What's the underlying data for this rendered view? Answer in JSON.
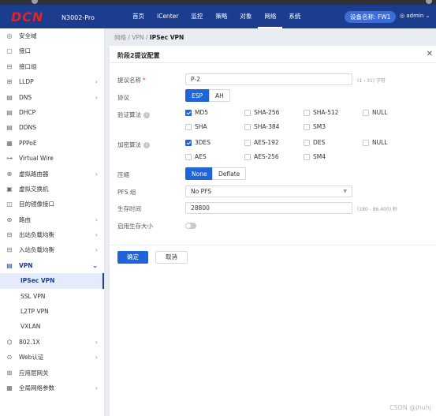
{
  "header": {
    "logo": "DCN",
    "model": "N3002-Pro",
    "nav": [
      "首页",
      "iCenter",
      "监控",
      "策略",
      "对象",
      "网络",
      "系统"
    ],
    "active_nav": "网络",
    "device_badge": "设备名称: FW1",
    "user": "admin"
  },
  "sidebar": {
    "items": [
      {
        "label": "安全域",
        "icon": "shield-icon",
        "glyph": "◎"
      },
      {
        "label": "接口",
        "icon": "interface-icon",
        "glyph": "▢"
      },
      {
        "label": "接口组",
        "icon": "interface-group-icon",
        "glyph": "⊟"
      },
      {
        "label": "LLDP",
        "icon": "lldp-icon",
        "glyph": "⊞",
        "arrow": true
      },
      {
        "label": "DNS",
        "icon": "dns-icon",
        "glyph": "▤",
        "arrow": true
      },
      {
        "label": "DHCP",
        "icon": "dhcp-icon",
        "glyph": "▤"
      },
      {
        "label": "DDNS",
        "icon": "ddns-icon",
        "glyph": "▤"
      },
      {
        "label": "PPPoE",
        "icon": "pppoe-icon",
        "glyph": "▦"
      },
      {
        "label": "Virtual Wire",
        "icon": "virtual-wire-icon",
        "glyph": "⊶"
      },
      {
        "label": "虚拟路由器",
        "icon": "virtual-router-icon",
        "glyph": "⊕",
        "arrow": true
      },
      {
        "label": "虚拟交换机",
        "icon": "virtual-switch-icon",
        "glyph": "▣"
      },
      {
        "label": "目的镜像接口",
        "icon": "mirror-icon",
        "glyph": "◫"
      },
      {
        "label": "路由",
        "icon": "route-icon",
        "glyph": "⊛",
        "arrow": true
      },
      {
        "label": "出站负载均衡",
        "icon": "outbound-lb-icon",
        "glyph": "⊟",
        "arrow": true
      },
      {
        "label": "入站负载均衡",
        "icon": "inbound-lb-icon",
        "glyph": "⊟",
        "arrow": true
      },
      {
        "label": "VPN",
        "icon": "vpn-icon",
        "glyph": "▤",
        "arrow": true,
        "open": true
      },
      {
        "label": "IPSec VPN",
        "sub": true,
        "active": true
      },
      {
        "label": "SSL VPN",
        "sub": true
      },
      {
        "label": "L2TP VPN",
        "sub": true
      },
      {
        "label": "VXLAN",
        "sub": true
      },
      {
        "label": "802.1X",
        "icon": "dot1x-icon",
        "glyph": "⌬",
        "arrow": true
      },
      {
        "label": "Web认证",
        "icon": "web-auth-icon",
        "glyph": "⊙",
        "arrow": true
      },
      {
        "label": "应用层网关",
        "icon": "alg-icon",
        "glyph": "⊞"
      },
      {
        "label": "全局网络参数",
        "icon": "global-params-icon",
        "glyph": "▦",
        "arrow": true
      }
    ]
  },
  "breadcrumb": {
    "path": "网络 / VPN / ",
    "current": "IPSec VPN"
  },
  "form": {
    "title": "阶段2提议配置",
    "name_label": "提议名称",
    "name_value": "P-2",
    "name_hint": "(1 - 31) 字符",
    "protocol_label": "协议",
    "protocol_esp": "ESP",
    "protocol_ah": "AH",
    "auth_label": "验证算法",
    "auth_options": [
      {
        "label": "MD5",
        "checked": true
      },
      {
        "label": "SHA-256",
        "checked": false
      },
      {
        "label": "SHA-512",
        "checked": false
      },
      {
        "label": "NULL",
        "checked": false
      },
      {
        "label": "SHA",
        "checked": false
      },
      {
        "label": "SHA-384",
        "checked": false
      },
      {
        "label": "SM3",
        "checked": false
      }
    ],
    "enc_label": "加密算法",
    "enc_options": [
      {
        "label": "3DES",
        "checked": true
      },
      {
        "label": "AES-192",
        "checked": false
      },
      {
        "label": "DES",
        "checked": false
      },
      {
        "label": "NULL",
        "checked": false
      },
      {
        "label": "AES",
        "checked": false
      },
      {
        "label": "AES-256",
        "checked": false
      },
      {
        "label": "SM4",
        "checked": false
      }
    ],
    "compress_label": "压缩",
    "compress_none": "None",
    "compress_deflate": "Deflate",
    "pfs_label": "PFS 组",
    "pfs_value": "No PFS",
    "lifetime_label": "生存时间",
    "lifetime_value": "28800",
    "lifetime_hint": "(180 - 86,400) 秒",
    "lifesize_label": "启用生存大小",
    "lifesize_enabled": false,
    "ok": "确定",
    "cancel": "取消"
  },
  "watermark": "CSDN @jhuhj",
  "colors": {
    "nav_bg": "#1c3c8e",
    "primary": "#1f64d8",
    "logo": "#e62222"
  }
}
